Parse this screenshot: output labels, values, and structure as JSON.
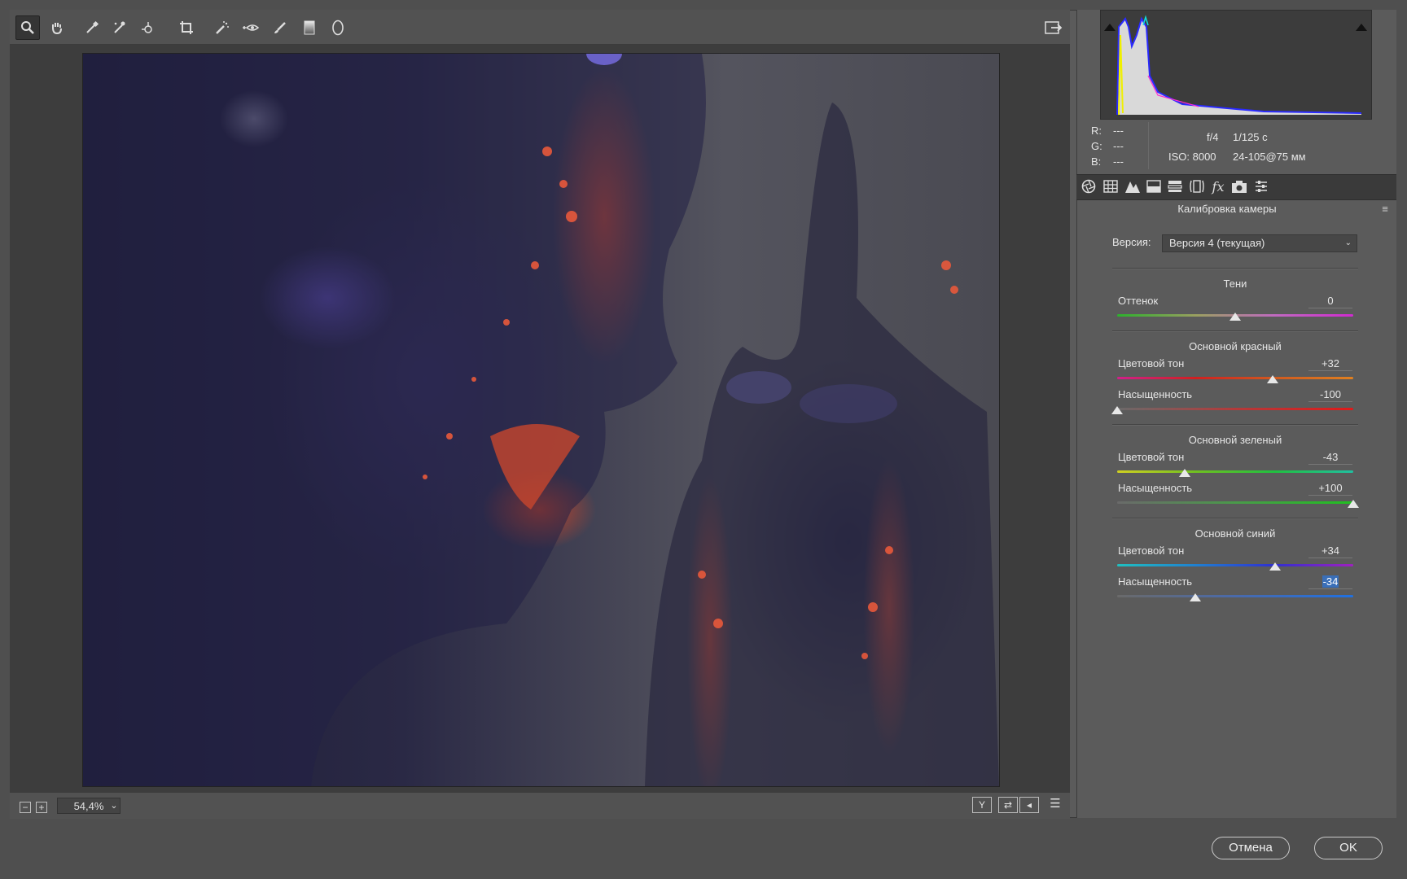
{
  "toolbar": {
    "tools": [
      "zoom-icon",
      "hand-icon",
      "eyedropper-icon",
      "color-sampler-icon",
      "targeted-adjust-icon",
      "crop-icon",
      "spot-removal-icon",
      "red-eye-icon",
      "adjustment-brush-icon",
      "graduated-filter-icon",
      "radial-filter-icon"
    ],
    "open_preferences_icon": "export-icon"
  },
  "status": {
    "zoom": "54,4%",
    "zoom_out": "−",
    "zoom_in": "+",
    "view_buttons": [
      "Y",
      "⇄",
      "◂",
      "☰"
    ]
  },
  "histogram": {
    "r_label": "R:",
    "r_value": "---",
    "g_label": "G:",
    "g_value": "---",
    "b_label": "B:",
    "b_value": "---",
    "aperture": "f/4",
    "shutter": "1/125 с",
    "iso": "ISO: 8000",
    "lens": "24-105@75 мм"
  },
  "panel": {
    "title": "Калибровка камеры",
    "menu_icon": "≡",
    "tabs": [
      "aperture-icon",
      "grid-icon",
      "mountain-icon",
      "split-icon",
      "hsl-icon",
      "lens-icon",
      "fx-icon",
      "camera-icon",
      "presets-icon"
    ],
    "version_label": "Версия:",
    "version_value": "Версия 4 (текущая)",
    "sections": [
      {
        "title": "Тени",
        "sliders": [
          {
            "label": "Оттенок",
            "value": "0",
            "min": -100,
            "max": 100,
            "num": 0
          }
        ]
      },
      {
        "title": "Основной красный",
        "sliders": [
          {
            "label": "Цветовой тон",
            "value": "+32",
            "min": -100,
            "max": 100,
            "num": 32
          },
          {
            "label": "Насыщенность",
            "value": "-100",
            "min": -100,
            "max": 100,
            "num": -100
          }
        ]
      },
      {
        "title": "Основной зеленый",
        "sliders": [
          {
            "label": "Цветовой тон",
            "value": "-43",
            "min": -100,
            "max": 100,
            "num": -43
          },
          {
            "label": "Насыщенность",
            "value": "+100",
            "min": -100,
            "max": 100,
            "num": 100
          }
        ]
      },
      {
        "title": "Основной синий",
        "sliders": [
          {
            "label": "Цветовой тон",
            "value": "+34",
            "min": -100,
            "max": 100,
            "num": 34
          },
          {
            "label": "Насыщенность",
            "value": "-34",
            "min": -100,
            "max": 100,
            "num": -34
          }
        ]
      }
    ]
  },
  "footer": {
    "cancel": "Отмена",
    "ok": "OK"
  },
  "colors": {
    "selection": "#3a6fb8",
    "panel_bg": "#5b5b5b",
    "canvas_bg": "#3d3d3d"
  }
}
